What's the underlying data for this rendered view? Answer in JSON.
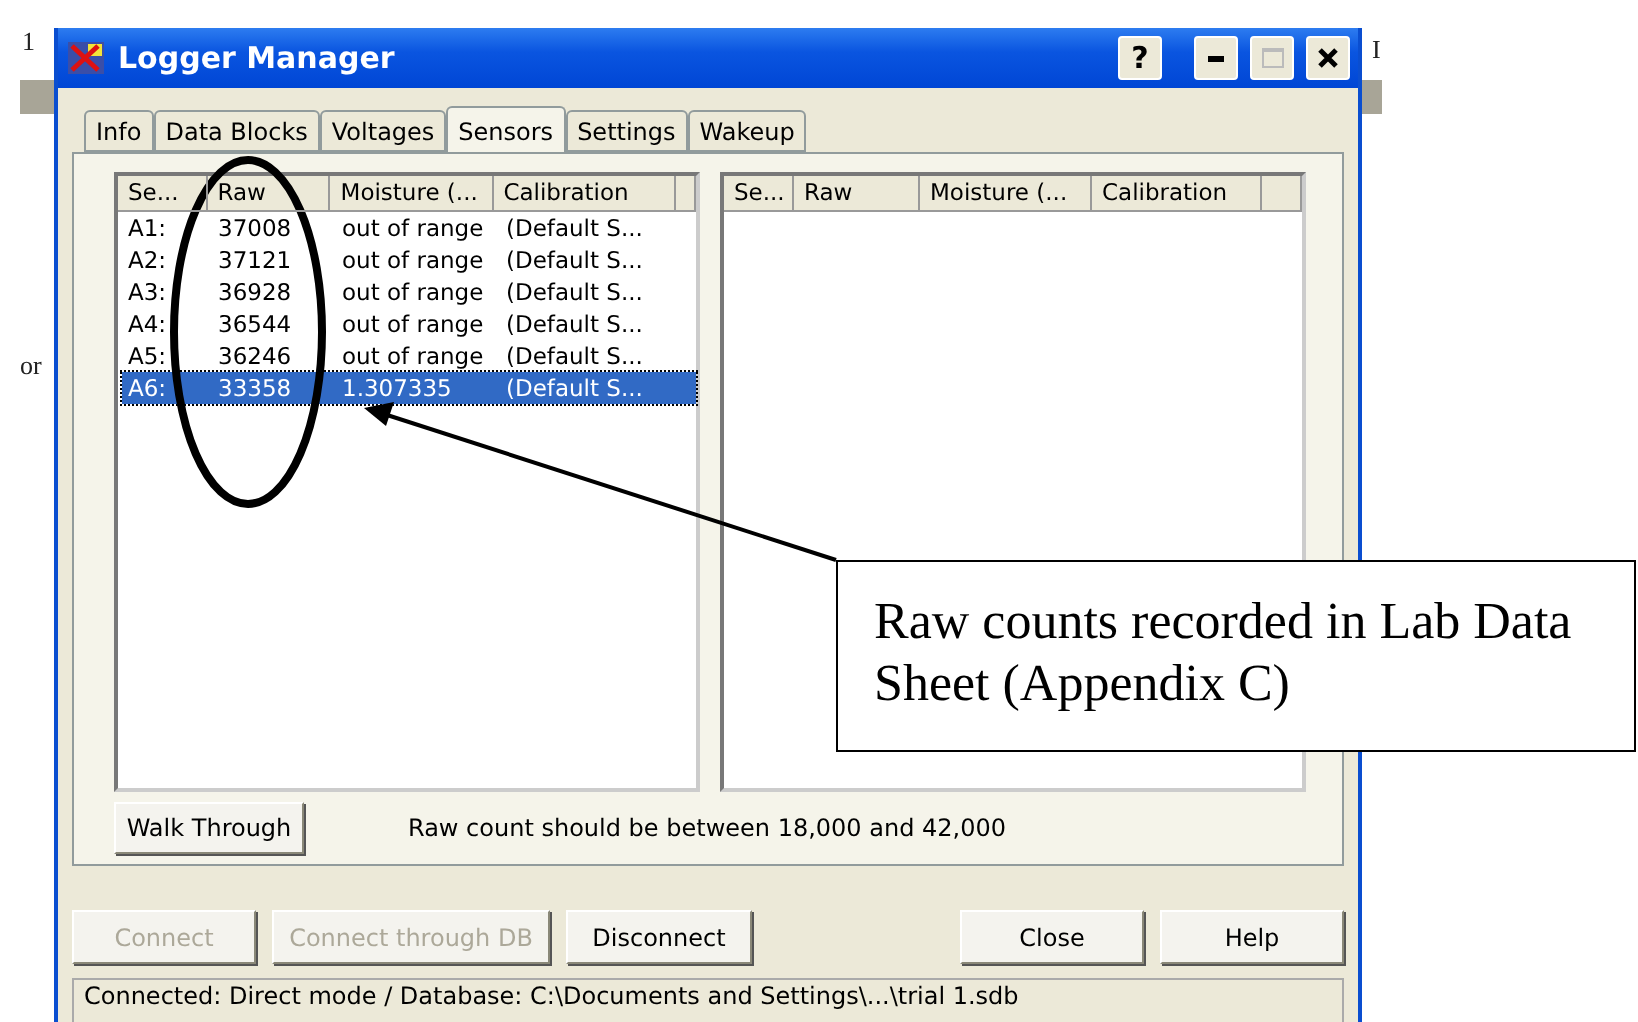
{
  "background_texts": [
    "1",
    "or",
    "I"
  ],
  "window": {
    "title": "Logger Manager",
    "title_buttons": [
      {
        "kind": "help",
        "label": "?"
      },
      {
        "kind": "minimize"
      },
      {
        "kind": "maximize"
      },
      {
        "kind": "close"
      }
    ]
  },
  "tabs": [
    {
      "label": "Info",
      "selected": false
    },
    {
      "label": "Data Blocks",
      "selected": false
    },
    {
      "label": "Voltages",
      "selected": false
    },
    {
      "label": "Sensors",
      "selected": true
    },
    {
      "label": "Settings",
      "selected": false
    },
    {
      "label": "Wakeup",
      "selected": false
    }
  ],
  "left_list": {
    "columns": [
      "Se...",
      "Raw",
      "Moisture (...",
      "Calibration"
    ],
    "rows": [
      {
        "cells": [
          "A1:",
          "37008",
          "out of range",
          "(Default S..."
        ],
        "selected": false
      },
      {
        "cells": [
          "A2:",
          "37121",
          "out of range",
          "(Default S..."
        ],
        "selected": false
      },
      {
        "cells": [
          "A3:",
          "36928",
          "out of range",
          "(Default S..."
        ],
        "selected": false
      },
      {
        "cells": [
          "A4:",
          "36544",
          "out of range",
          "(Default S..."
        ],
        "selected": false
      },
      {
        "cells": [
          "A5:",
          "36246",
          "out of range",
          "(Default S..."
        ],
        "selected": false
      },
      {
        "cells": [
          "A6:",
          "33358",
          "1.307335",
          "(Default S..."
        ],
        "selected": true
      }
    ]
  },
  "right_list": {
    "columns": [
      "Se...",
      "Raw",
      "Moisture (...",
      "Calibration"
    ]
  },
  "walk_through_button": "Walk Through",
  "hint": "Raw count should be between 18,000 and 42,000",
  "buttons": [
    {
      "label": "Connect",
      "disabled": true
    },
    {
      "label": "Connect through DB",
      "disabled": true
    },
    {
      "label": "Disconnect",
      "disabled": false
    },
    {
      "label": "Close",
      "disabled": false
    },
    {
      "label": "Help",
      "disabled": false
    }
  ],
  "status_bar": "Connected: Direct mode  /  Database: C:\\Documents and Settings\\...\\trial 1.sdb",
  "annotation": {
    "callout": "Raw counts recorded in Lab Data Sheet (Appendix C)"
  }
}
